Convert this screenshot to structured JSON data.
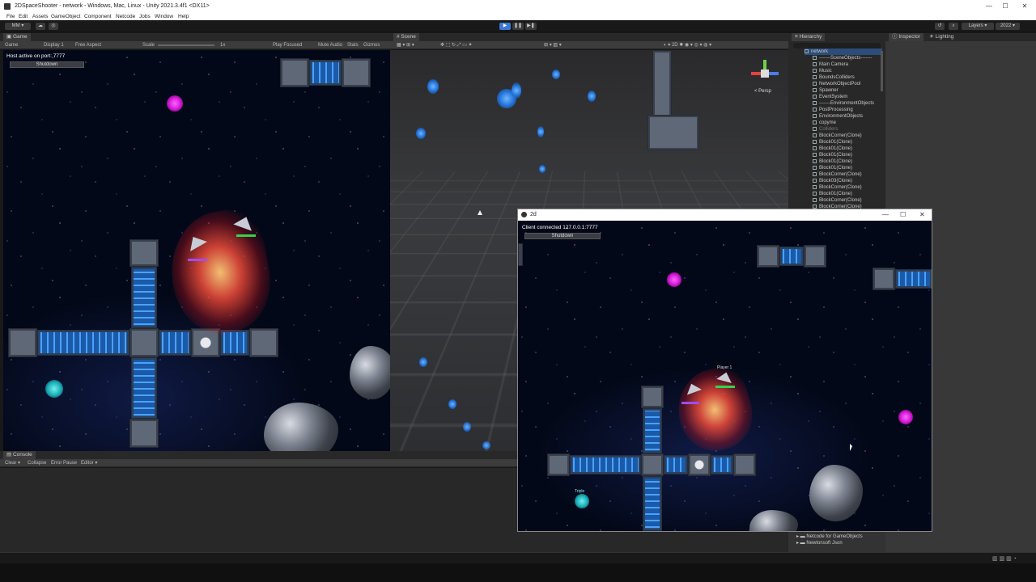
{
  "window": {
    "title": "2DSpaceShooter - network - Windows, Mac, Linux - Unity 2021.3.4f1 <DX11>",
    "controls": [
      "—",
      "☐",
      "✕"
    ]
  },
  "menu": [
    "File",
    "Edit",
    "Assets",
    "GameObject",
    "Component",
    "Netcode",
    "Jobs",
    "Window",
    "Help"
  ],
  "toolbar": {
    "account": "MM ▾",
    "layers": "Layers",
    "layout": "2022"
  },
  "game_view": {
    "tab": "Game",
    "sub": {
      "mode": "Game",
      "display": "Display 1",
      "aspect": "Free Aspect",
      "scale_label": "Scale",
      "scale_value": "1x",
      "play_focused": "Play Focused",
      "mute": "Mute Audio",
      "stats": "Stats",
      "gizmos": "Gizmos"
    },
    "status": "Host active on port: 7777",
    "shutdown": "Shutdown"
  },
  "scene_view": {
    "tab": "Scene",
    "persp": "< Persp"
  },
  "hierarchy": {
    "tab": "Hierarchy",
    "root": "network",
    "items": [
      "-------SceneObjects-------",
      "Main Camera",
      "Music",
      "BoundsColliders",
      "NetworkObjectPool",
      "Spawner",
      "EventSystem",
      "-------EnvironmentObjects",
      "PostProcessing",
      "EnvironmentObjects",
      "copyme",
      "Colliders",
      "BlockCorner(Clone)",
      "Block01(Clone)",
      "Block01(Clone)",
      "Block01(Clone)",
      "Block01(Clone)",
      "Block01(Clone)",
      "BlockCorner(Clone)",
      "Block03(Clone)",
      "BlockCorner(Clone)",
      "Block01(Clone)",
      "BlockCorner(Clone)",
      "BlockCorner(Clone)"
    ]
  },
  "inspector": {
    "tab": "Inspector",
    "lighting": "Lighting"
  },
  "console": {
    "tab": "Console",
    "clear": "Clear ▾",
    "collapse": "Collapse",
    "error_pause": "Error Pause",
    "editor": "Editor ▾"
  },
  "project": {
    "items": [
      "Netcode for GameObjects",
      "Newtonsoft Json"
    ]
  },
  "client_window": {
    "title": "2d",
    "controls": [
      "—",
      "☐",
      "✕"
    ],
    "status": "Client connected 127.0.0.1:7777",
    "shutdown": "Shutdown",
    "player_label": "Player 1",
    "pickup_label": "Triple"
  },
  "colors": {
    "accent_play": "#3a79d4",
    "editor_bg": "#191919",
    "hp_green": "#34d34a",
    "orb_magenta": "#e020e0",
    "orb_teal": "#22c9c9"
  }
}
